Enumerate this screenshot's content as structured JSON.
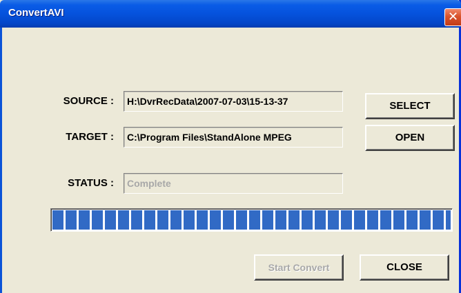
{
  "window": {
    "title": "ConvertAVI",
    "close_glyph": "✕"
  },
  "source": {
    "label": "SOURCE :",
    "value": "H:\\DvrRecData\\2007-07-03\\15-13-37"
  },
  "target": {
    "label": "TARGET :",
    "value": "C:\\Program Files\\StandAlone MPEG"
  },
  "status": {
    "label": "STATUS :",
    "value": "Complete"
  },
  "progress": {
    "fraction": 1.0
  },
  "buttons": {
    "select": "SELECT",
    "open": "OPEN",
    "start_convert": "Start Convert",
    "close": "CLOSE"
  },
  "colors": {
    "titlebar": "#0552dd",
    "progress_block": "#316ac5",
    "face": "#ece9d8",
    "close_button": "#d8532c"
  },
  "icons": {
    "close": "close-icon"
  }
}
